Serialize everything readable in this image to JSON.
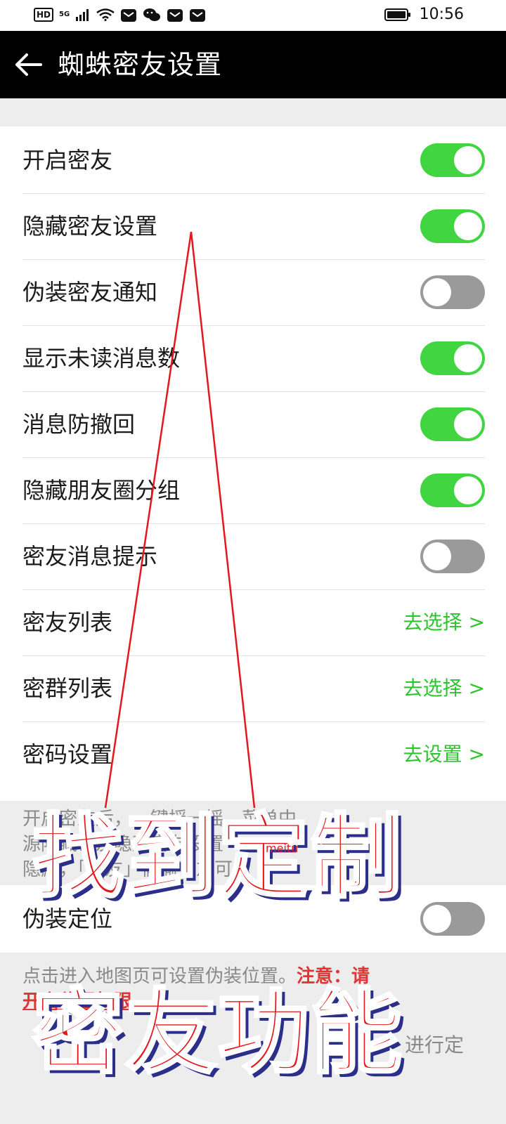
{
  "status_bar": {
    "hd": "HD",
    "network": "5G",
    "time": "10:56",
    "icons": [
      "signal-icon",
      "wifi-icon",
      "mail-icon",
      "wechat-icon",
      "mail-icon",
      "mail-icon",
      "battery-icon"
    ]
  },
  "header": {
    "back_icon": "arrow-left-icon",
    "title": "蜘蛛密友设置"
  },
  "settings": [
    {
      "label": "开启密友",
      "type": "toggle",
      "on": true
    },
    {
      "label": "隐藏密友设置",
      "type": "toggle",
      "on": true
    },
    {
      "label": "伪装密友通知",
      "type": "toggle",
      "on": false
    },
    {
      "label": "显示未读消息数",
      "type": "toggle",
      "on": true
    },
    {
      "label": "消息防撤回",
      "type": "toggle",
      "on": true
    },
    {
      "label": "隐藏朋友圈分组",
      "type": "toggle",
      "on": true
    },
    {
      "label": "密友消息提示",
      "type": "toggle",
      "on": false
    },
    {
      "label": "密友列表",
      "type": "link",
      "action": "去选择 >"
    },
    {
      "label": "密群列表",
      "type": "link",
      "action": "去选择 >"
    },
    {
      "label": "密码设置",
      "type": "link",
      "action": "去设置 >"
    }
  ],
  "desc1": {
    "line1": "开启密友后，一键摇一摇，菜单中",
    "line2": "源隐藏密友隐藏密友设置",
    "line3": "隐藏，「密友」偷偷密友可"
  },
  "fake_location": {
    "label": "伪装定位",
    "on": false
  },
  "desc2": {
    "line1_normal": "点击进入地图页可设置伪装位置。",
    "line1_warn": "注意：请",
    "line2": "开启位置权限",
    "button": "进行定"
  },
  "overlay": {
    "caption_line1": "找到定制",
    "caption_line2": "密友功能",
    "watermark": "meitu"
  },
  "colors": {
    "toggle_on": "#41d641",
    "toggle_off": "#9a9a9a",
    "link_green": "#2dc52d",
    "caption_red": "#e3171c",
    "caption_shadow": "#2b2f8a",
    "header_bg": "#000000"
  }
}
